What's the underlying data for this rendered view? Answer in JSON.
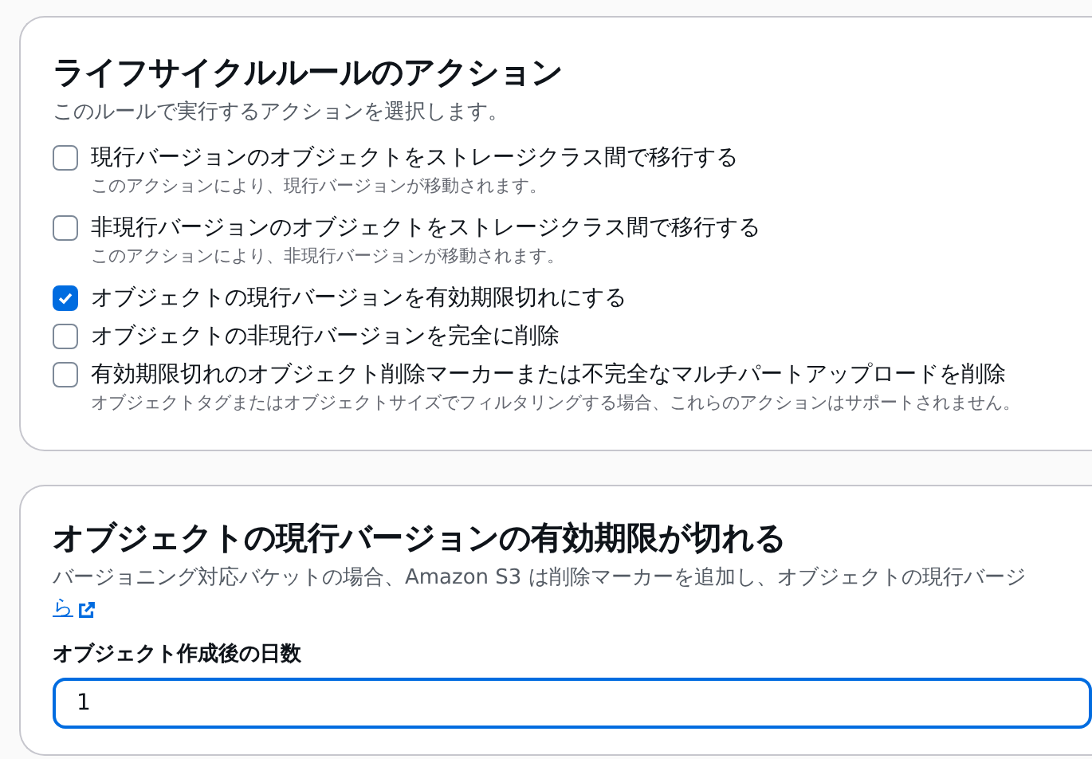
{
  "actions_panel": {
    "title": "ライフサイクルルールのアクション",
    "description": "このルールで実行するアクションを選択します。",
    "options": [
      {
        "label": "現行バージョンのオブジェクトをストレージクラス間で移行する",
        "hint": "このアクションにより、現行バージョンが移動されます。",
        "checked": false
      },
      {
        "label": "非現行バージョンのオブジェクトをストレージクラス間で移行する",
        "hint": "このアクションにより、非現行バージョンが移動されます。",
        "checked": false
      },
      {
        "label": "オブジェクトの現行バージョンを有効期限切れにする",
        "checked": true
      },
      {
        "label": "オブジェクトの非現行バージョンを完全に削除",
        "checked": false
      },
      {
        "label": "有効期限切れのオブジェクト削除マーカーまたは不完全なマルチパートアップロードを削除",
        "hint": "オブジェクトタグまたはオブジェクトサイズでフィルタリングする場合、これらのアクションはサポートされません。",
        "checked": false
      }
    ]
  },
  "expiration_panel": {
    "title": "オブジェクトの現行バージョンの有効期限が切れる",
    "description": "バージョニング対応バケットの場合、Amazon S3 は削除マーカーを追加し、オブジェクトの現行バージ",
    "link": "ら",
    "field": {
      "label": "オブジェクト作成後の日数",
      "value": "1"
    }
  }
}
